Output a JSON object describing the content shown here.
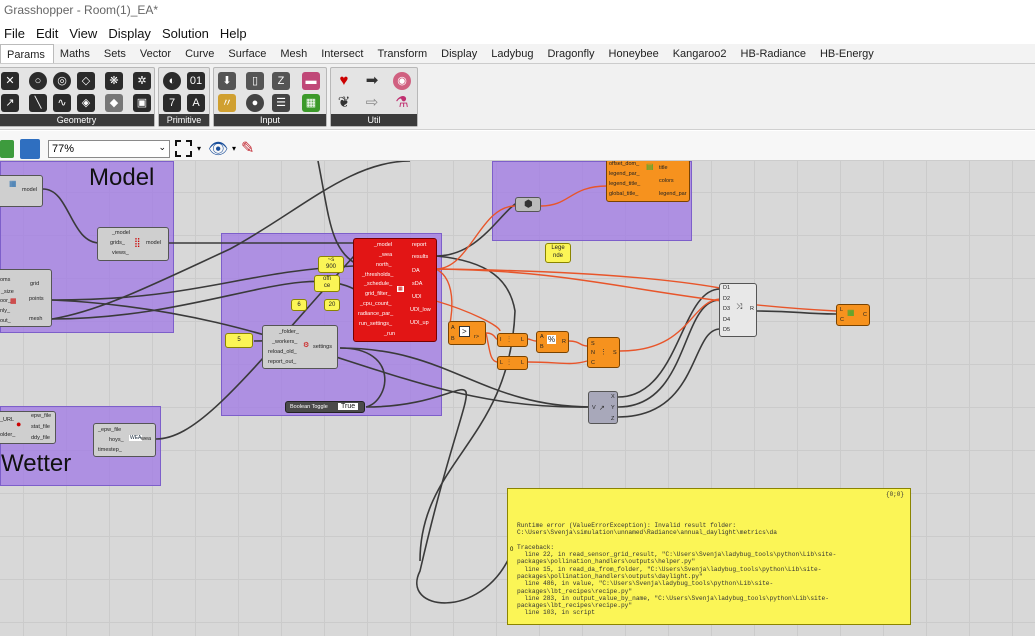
{
  "title": "Grasshopper - Room(1)_EA*",
  "menu": [
    "File",
    "Edit",
    "View",
    "Display",
    "Solution",
    "Help"
  ],
  "tabs": [
    "Params",
    "Maths",
    "Sets",
    "Vector",
    "Curve",
    "Surface",
    "Mesh",
    "Intersect",
    "Transform",
    "Display",
    "Ladybug",
    "Dragonfly",
    "Honeybee",
    "Kangaroo2",
    "HB-Radiance",
    "HB-Energy"
  ],
  "ribbon_groups": [
    "Geometry",
    "Primitive",
    "Input",
    "Util"
  ],
  "zoom": "77%",
  "colors": {
    "group": "#a078e6",
    "wire_orange": "#e8552a",
    "canvas": "#d8d8d8",
    "error_panel": "#fbf556"
  },
  "canvas": {
    "group_model_title": "Model",
    "group_wetter_title": "Wetter",
    "model_comp": {
      "in0": "_model",
      "in1": "grids_",
      "in2": "views_",
      "out": "model"
    },
    "left_partial": {
      "out0": "model",
      "in_grid_a": "oms",
      "in_grid_b": "_size",
      "out_grid": "grid",
      "in_points_a": "oor_",
      "in_points_b": "nly_",
      "out_points": "points",
      "in_mesh": "out_",
      "out_mesh": "mesh"
    },
    "daylight": {
      "inputs": [
        "_model",
        "_wea",
        "north_",
        "_thresholds_",
        "_schedule_",
        "grid_filter_",
        "_cpu_count_",
        "radiance_par_",
        "run_settings_",
        "_run"
      ],
      "outputs": [
        "report",
        "results",
        "DA",
        "sDA",
        "UDI",
        "UDI_low",
        "UDI_up"
      ]
    },
    "settings_comp": {
      "inputs": [
        "_folder_",
        "_workers_",
        "reload_old_",
        "report_out_"
      ],
      "out": "settings"
    },
    "panels": {
      "p900": "~s\n900",
      "office": "offi\nce",
      "p20": "20",
      "p6": "6",
      "p5": "5",
      "legende": "Lege\nnde"
    },
    "toggle": {
      "label": "Boolean Toggle",
      "value": "True"
    },
    "legend_par": {
      "inputs": [
        "offset_dom_",
        "legend_par_",
        "legend_title_",
        "global_title_"
      ],
      "outputs": [
        "title",
        "colors",
        "legend_par"
      ]
    },
    "compare": {
      "in_a": "A",
      "in_b": "B",
      "sym": ">",
      "out": "r>"
    },
    "bounds_a": {
      "label": "I",
      "out": "L"
    },
    "bounds_b": {
      "label": "L",
      "out": "L"
    },
    "div": {
      "in_a": "A",
      "in_b": "B",
      "out": "R"
    },
    "srn": {
      "in0": "S",
      "in1": "N",
      "in2": "C",
      "out": "S"
    },
    "merge": {
      "inputs": [
        "D1",
        "D2",
        "D3",
        "D4",
        "D5"
      ],
      "out": "R"
    },
    "deconstruct": {
      "in": "V",
      "outputs": [
        "X",
        "Y",
        "Z"
      ]
    },
    "colour": {
      "in0": "L",
      "in1": "C",
      "out": "C"
    },
    "wea": {
      "inputs": [
        "epw_file",
        "stat_file",
        "ddy_file"
      ],
      "in_partial": [
        "_URL",
        "older_"
      ],
      "epw_in": "_epw_file",
      "hoys": "hoys_",
      "ts": "timestep_",
      "out": "wea"
    },
    "error": {
      "corner": "{0;0}",
      "text": "Runtime error (ValueErrorException): Invalid result folder:\nC:\\Users\\Svenja\\simulation\\unnamed\\Radiance\\annual_daylight\\metrics\\da\n\nTraceback:\n  line 22, in read_sensor_grid_result, \"C:\\Users\\Svenja\\ladybug_tools\\python\\Lib\\site-\npackages\\pollination_handlers\\outputs\\helper.py\"\n  line 15, in read_da_from_folder, \"C:\\Users\\Svenja\\ladybug_tools\\python\\Lib\\site-\npackages\\pollination_handlers\\outputs\\daylight.py\"\n  line 486, in value, \"C:\\Users\\Svenja\\ladybug_tools\\python\\Lib\\site-\npackages\\lbt_recipes\\recipe.py\"\n  line 283, in output_value_by_name, \"C:\\Users\\Svenja\\ladybug_tools\\python\\Lib\\site-\npackages\\lbt_recipes\\recipe.py\"\n  line 103, in script",
      "in_label": "0"
    }
  }
}
